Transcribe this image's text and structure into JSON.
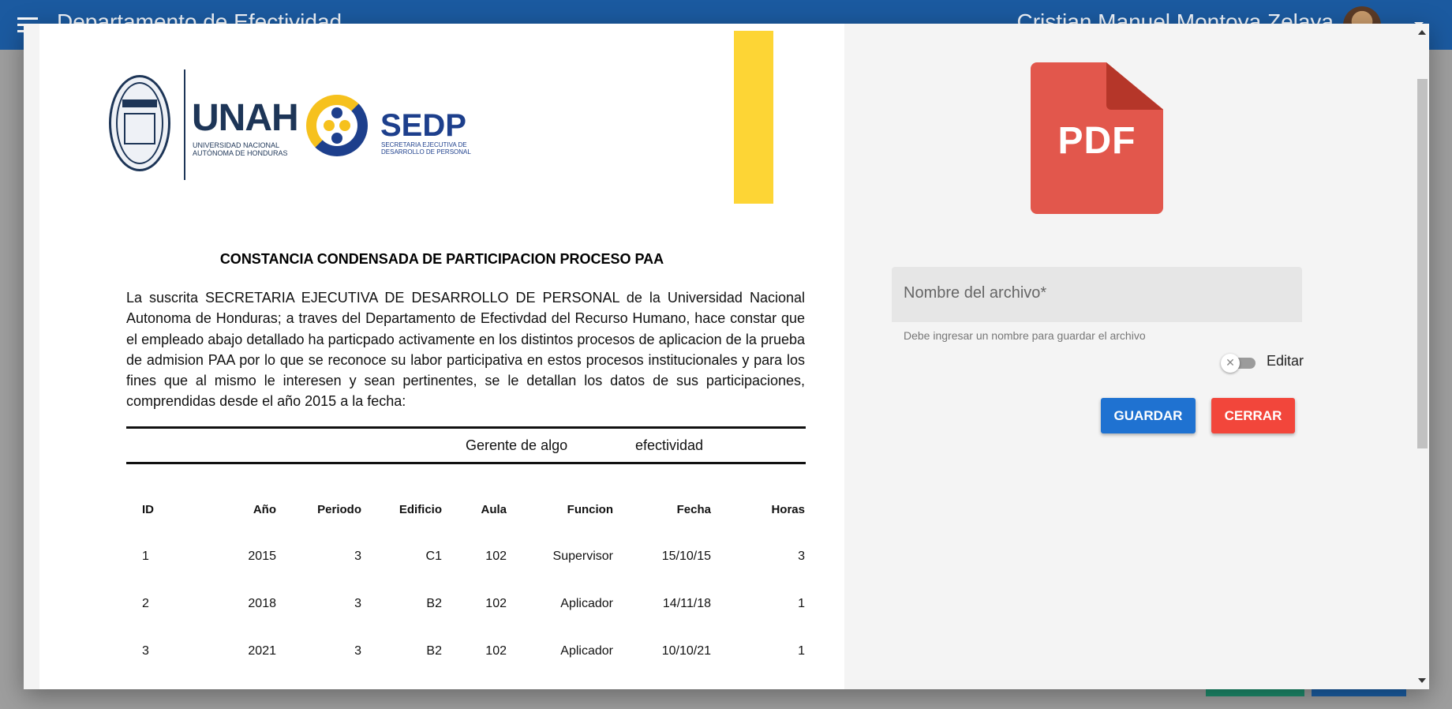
{
  "appbar": {
    "title": "Departamento de Efectividad",
    "user_name": "Cristian Manuel Montoya Zelaya"
  },
  "document": {
    "logos": {
      "unah_name": "UNAH",
      "unah_subtitle": "UNIVERSIDAD NACIONAL AUTÓNOMA DE HONDURAS",
      "sedp_name": "SEDP",
      "sedp_subtitle": "SECRETARIA EJECUTIVA DE DESARROLLO DE PERSONAL"
    },
    "title": "CONSTANCIA CONDENSADA DE PARTICIPACION PROCESO PAA",
    "paragraph": "La suscrita SECRETARIA EJECUTIVA DE DESARROLLO DE PERSONAL de la Universidad Nacional Autonoma de Honduras; a traves del Departamento de Efectivdad del Recurso Humano, hace constar que el empleado abajo detallado ha particpado activamente en los distintos procesos de aplicacion de la prueba de admision PAA por lo que se reconoce su labor participativa en estos procesos institucionales y para los fines que al mismo le interesen y sean pertinentes, se le detallan los datos de sus participaciones, comprendidas desde el año 2015 a la fecha:",
    "employee": {
      "position": "Gerente de algo",
      "department": "efectividad"
    },
    "table": {
      "headers": [
        "ID",
        "Año",
        "Periodo",
        "Edificio",
        "Aula",
        "Funcion",
        "Fecha",
        "Horas"
      ],
      "rows": [
        [
          "1",
          "2015",
          "3",
          "C1",
          "102",
          "Supervisor",
          "15/10/15",
          "3"
        ],
        [
          "2",
          "2018",
          "3",
          "B2",
          "102",
          "Aplicador",
          "14/11/18",
          "1"
        ],
        [
          "3",
          "2021",
          "3",
          "B2",
          "102",
          "Aplicador",
          "10/10/21",
          "1"
        ]
      ]
    }
  },
  "panel": {
    "pdf_label": "PDF",
    "filename_label": "Nombre del archivo*",
    "filename_hint": "Debe ingresar un nombre para guardar el archivo",
    "toggle_label": "Editar",
    "toggle_on": false,
    "save_label": "GUARDAR",
    "close_label": "CERRAR"
  },
  "colors": {
    "primary": "#1b5aa0",
    "save_button": "#1f72d1",
    "close_button": "#f2463b",
    "pdf_red": "#e2574c",
    "accent_yellow": "#fdd535"
  }
}
